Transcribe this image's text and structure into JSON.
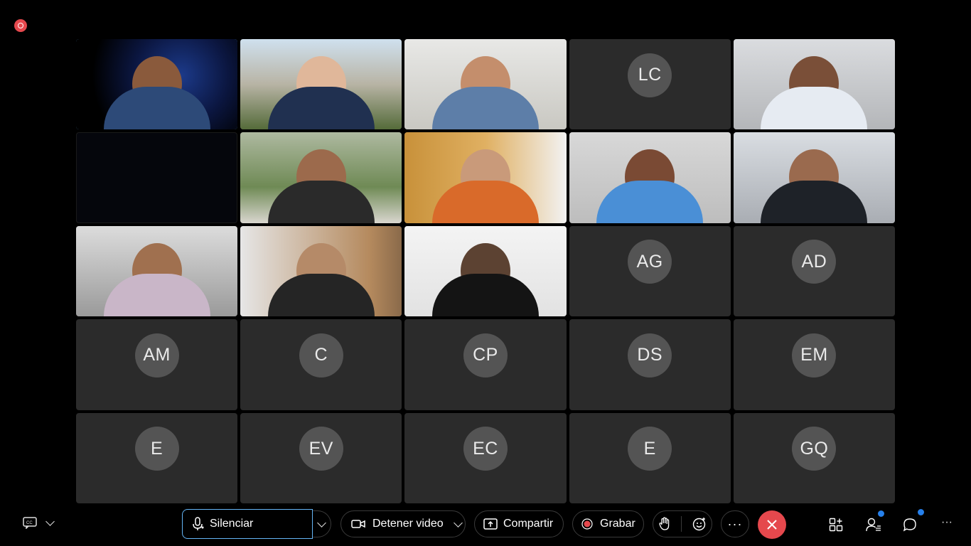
{
  "participants": [
    {
      "type": "video",
      "self": true
    },
    {
      "type": "video"
    },
    {
      "type": "video"
    },
    {
      "type": "avatar",
      "initials": "LC"
    },
    {
      "type": "video"
    },
    {
      "type": "dark"
    },
    {
      "type": "video"
    },
    {
      "type": "video"
    },
    {
      "type": "video"
    },
    {
      "type": "video"
    },
    {
      "type": "video"
    },
    {
      "type": "video"
    },
    {
      "type": "video"
    },
    {
      "type": "avatar",
      "initials": "AG"
    },
    {
      "type": "avatar",
      "initials": "AD"
    },
    {
      "type": "avatar",
      "initials": "AM"
    },
    {
      "type": "avatar",
      "initials": "C"
    },
    {
      "type": "avatar",
      "initials": "CP"
    },
    {
      "type": "avatar",
      "initials": "DS"
    },
    {
      "type": "avatar",
      "initials": "EM"
    },
    {
      "type": "avatar",
      "initials": "E"
    },
    {
      "type": "avatar",
      "initials": "EV"
    },
    {
      "type": "avatar",
      "initials": "EC"
    },
    {
      "type": "avatar",
      "initials": "E"
    },
    {
      "type": "avatar",
      "initials": "GQ"
    }
  ],
  "toolbar": {
    "mute_label": "Silenciar",
    "stop_video_label": "Detener video",
    "share_label": "Compartir",
    "record_label": "Grabar"
  },
  "colors": {
    "accent": "#64b5f6",
    "end_call": "#e5484d",
    "badge": "#2680eb"
  }
}
